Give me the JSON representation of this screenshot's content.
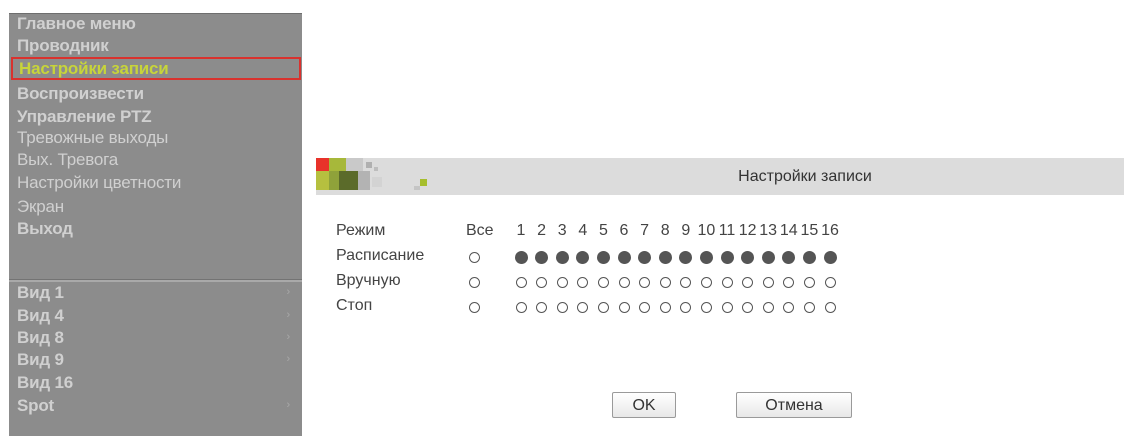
{
  "menu": {
    "top_items": [
      {
        "label": "Главное меню",
        "active": false
      },
      {
        "label": "Проводник",
        "active": false
      },
      {
        "label": "Настройки записи",
        "active": true
      },
      {
        "label": "Воспроизвести",
        "active": false
      },
      {
        "label": "Управление PTZ",
        "active": false
      },
      {
        "label": "Тревожные выходы",
        "active": false
      },
      {
        "label": "Вых. Тревога",
        "active": false
      },
      {
        "label": "Настройки цветности",
        "active": false
      },
      {
        "label": "Экран",
        "active": false
      },
      {
        "label": "Выход",
        "active": false
      }
    ],
    "view_items": [
      {
        "label": "Вид 1",
        "has_submenu": true
      },
      {
        "label": "Вид 4",
        "has_submenu": true
      },
      {
        "label": "Вид 8",
        "has_submenu": true
      },
      {
        "label": "Вид 9",
        "has_submenu": true
      },
      {
        "label": "Вид 16",
        "has_submenu": false
      },
      {
        "label": "Spot",
        "has_submenu": true
      }
    ],
    "submenu_arrow": "›"
  },
  "dialog": {
    "title": "Настройки записи",
    "mode_label": "Режим",
    "all_label": "Все",
    "channels": [
      "1",
      "2",
      "3",
      "4",
      "5",
      "6",
      "7",
      "8",
      "9",
      "10",
      "11",
      "12",
      "13",
      "14",
      "15",
      "16"
    ],
    "rows": [
      {
        "label": "Расписание",
        "all_selected": false,
        "selected": [
          true,
          true,
          true,
          true,
          true,
          true,
          true,
          true,
          true,
          true,
          true,
          true,
          true,
          true,
          true,
          true
        ]
      },
      {
        "label": "Вручную",
        "all_selected": false,
        "selected": [
          false,
          false,
          false,
          false,
          false,
          false,
          false,
          false,
          false,
          false,
          false,
          false,
          false,
          false,
          false,
          false
        ]
      },
      {
        "label": "Стоп",
        "all_selected": false,
        "selected": [
          false,
          false,
          false,
          false,
          false,
          false,
          false,
          false,
          false,
          false,
          false,
          false,
          false,
          false,
          false,
          false
        ]
      }
    ],
    "ok_label": "OK",
    "cancel_label": "Отмена"
  },
  "colors": {
    "menu_bg": "#8c8c8c",
    "menu_text": "#d0d0d0",
    "menu_active_text": "#c7d43a",
    "menu_active_border": "#d9322e",
    "dialog_header_bg": "#dcdcdc"
  }
}
